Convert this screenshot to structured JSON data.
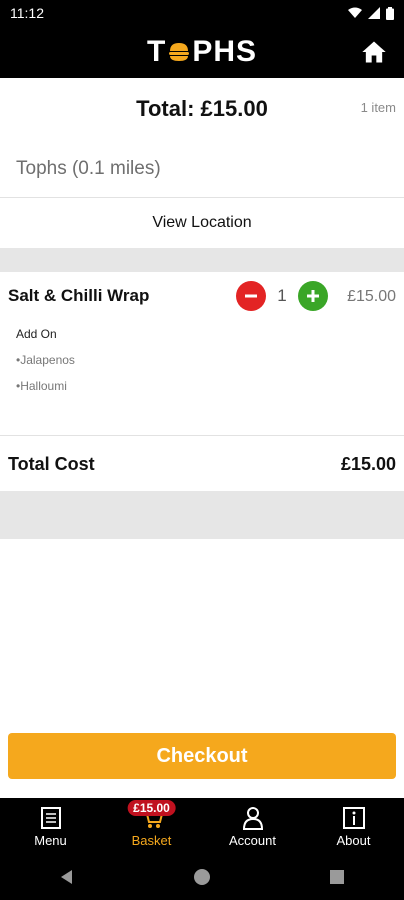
{
  "status_bar": {
    "time": "11:12"
  },
  "header": {
    "logo_left": "T",
    "logo_right": "PHS",
    "home_icon": "home-icon"
  },
  "summary": {
    "total_label": "Total: £15.00",
    "item_count": "1 item"
  },
  "store": {
    "name": "Tophs (0.1 miles)",
    "view_location": "View Location"
  },
  "basket_item": {
    "name": "Salt & Chilli Wrap",
    "quantity": "1",
    "price": "£15.00",
    "addon_title": "Add On",
    "addons": [
      "•Jalapenos",
      "•Halloumi"
    ]
  },
  "totals": {
    "label": "Total Cost",
    "value": "£15.00"
  },
  "checkout": {
    "label": "Checkout"
  },
  "bottom_nav": {
    "items": [
      {
        "label": "Menu",
        "icon": "menu-book-icon"
      },
      {
        "label": "Basket",
        "icon": "cart-icon",
        "badge": "£15.00"
      },
      {
        "label": "Account",
        "icon": "person-icon"
      },
      {
        "label": "About",
        "icon": "info-icon"
      }
    ]
  },
  "colors": {
    "accent": "#f5a81d",
    "minus": "#e32424",
    "plus": "#3aa627",
    "badge": "#c0111f"
  }
}
